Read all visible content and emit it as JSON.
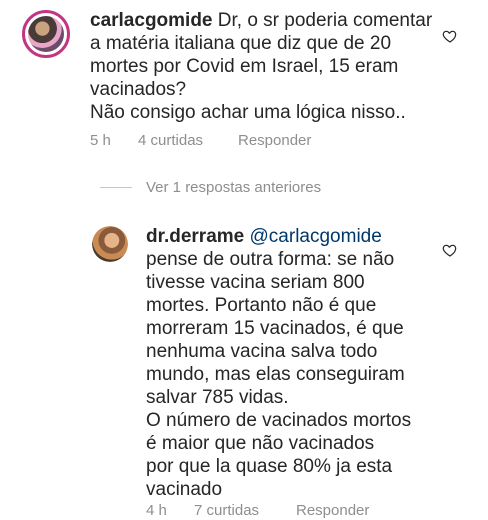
{
  "comments": [
    {
      "username": "carlacgomide",
      "text_lines": [
        "Dr, o sr poderia comentar",
        "a matéria italiana que diz que de 20",
        "mortes por Covid em Israel, 15 eram",
        "vacinados?",
        "Não consigo achar uma lógica nisso.."
      ],
      "time": "5 h",
      "likes": "4 curtidas",
      "reply_label": "Responder"
    }
  ],
  "view_replies": "Ver 1 respostas anteriores",
  "reply": {
    "username": "dr.derrame",
    "mention": "@carlacgomide",
    "text_lines": [
      "pense de outra forma: se não",
      "tivesse vacina seriam 800",
      "mortes. Portanto não é que",
      "morreram 15 vacinados, é que",
      "nenhuma vacina salva todo",
      "mundo, mas elas conseguiram",
      "salvar 785 vidas.",
      "O número de vacinados mortos",
      "é maior que não vacinados",
      "por que la quase 80% ja esta",
      "vacinado"
    ],
    "time": "4 h",
    "likes": "7 curtidas",
    "reply_label": "Responder"
  },
  "icons": {
    "like": "heart-outline-icon"
  },
  "colors": {
    "text": "#262626",
    "secondary": "#8e8e8e",
    "mention": "#00376b",
    "story_ring": "#c13584"
  }
}
